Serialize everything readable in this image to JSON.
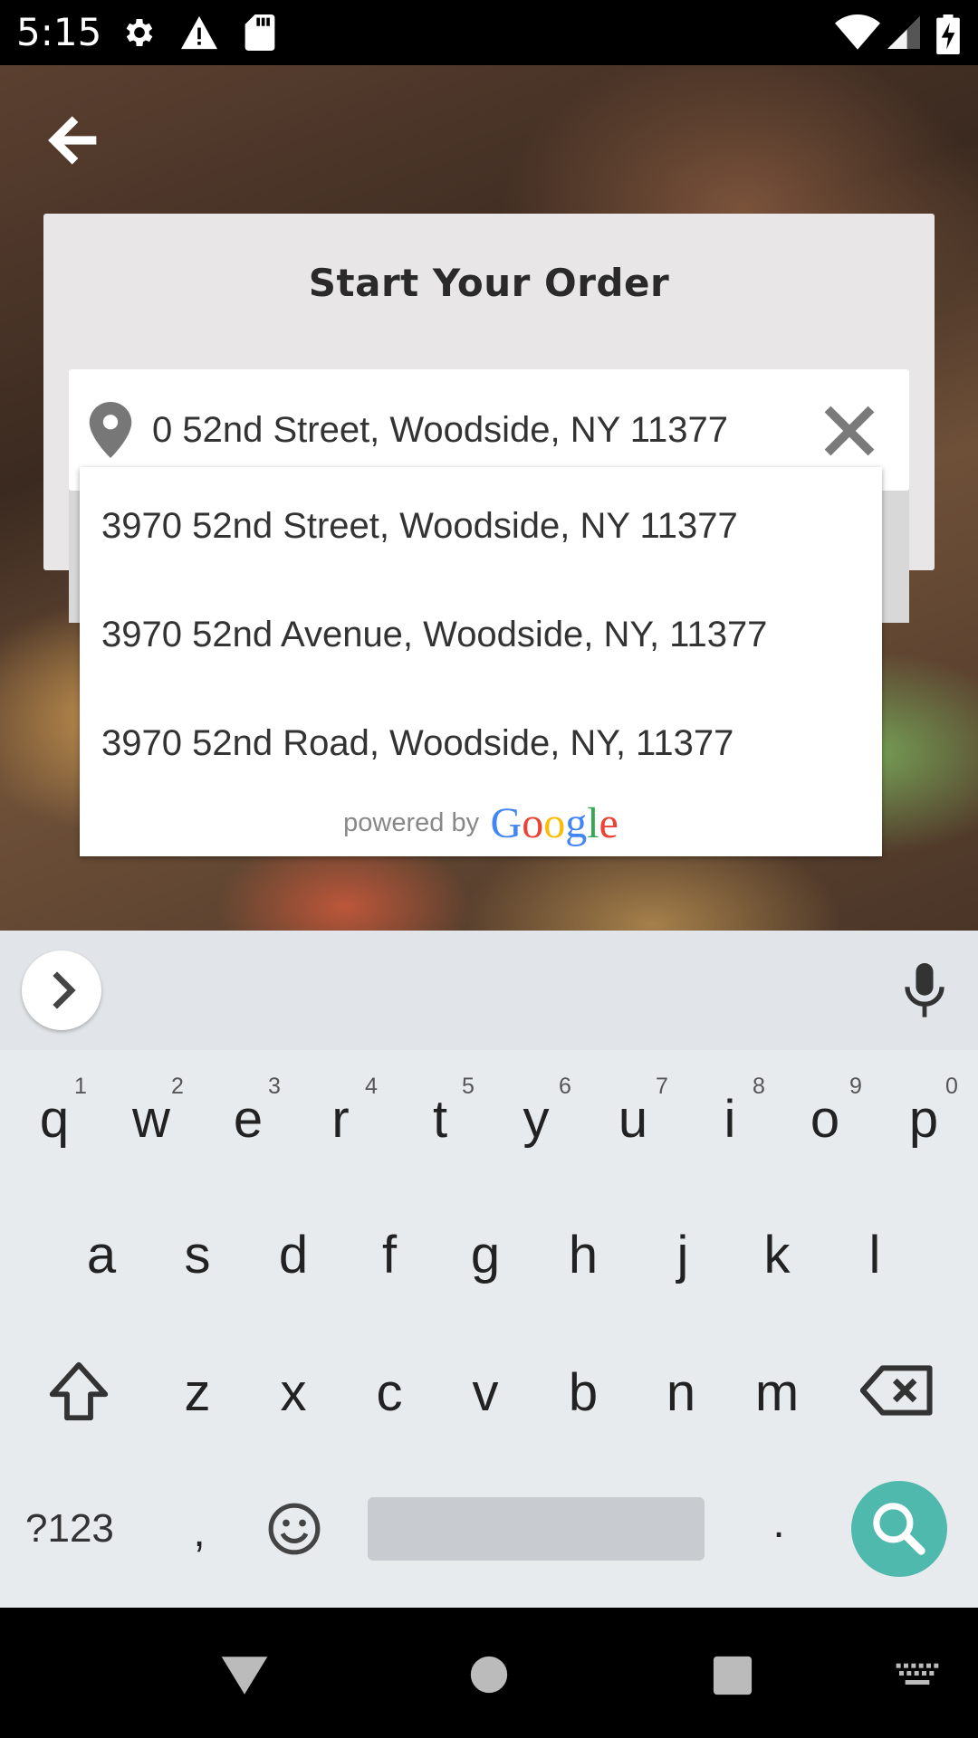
{
  "status_bar": {
    "time": "5:15",
    "left_icons": [
      "gear-icon",
      "warning-icon",
      "sd-card-icon"
    ],
    "right_icons": [
      "wifi-icon",
      "signal-icon",
      "battery-charging-icon"
    ]
  },
  "header": {
    "back_icon": "arrow-left-icon"
  },
  "card": {
    "title": "Start Your Order",
    "address_value": "0 52nd Street, Woodside, NY 11377"
  },
  "suggestions": {
    "items": [
      "3970 52nd Street, Woodside, NY 11377",
      "3970 52nd Avenue, Woodside, NY, 11377",
      "3970 52nd Road, Woodside, NY, 11377"
    ],
    "powered_by": "powered by",
    "google": "Google"
  },
  "keyboard": {
    "row1": [
      "q",
      "w",
      "e",
      "r",
      "t",
      "y",
      "u",
      "i",
      "o",
      "p"
    ],
    "row1_hints": [
      "1",
      "2",
      "3",
      "4",
      "5",
      "6",
      "7",
      "8",
      "9",
      "0"
    ],
    "row2": [
      "a",
      "s",
      "d",
      "f",
      "g",
      "h",
      "j",
      "k",
      "l"
    ],
    "row3": [
      "z",
      "x",
      "c",
      "v",
      "b",
      "n",
      "m"
    ],
    "symbols_key": "?123",
    "comma_key": ",",
    "period_key": "."
  },
  "colors": {
    "search_key": "#50b9ad",
    "google_blue": "#4285F4",
    "google_red": "#EA4335",
    "google_yellow": "#FBBC05",
    "google_green": "#34A853"
  }
}
